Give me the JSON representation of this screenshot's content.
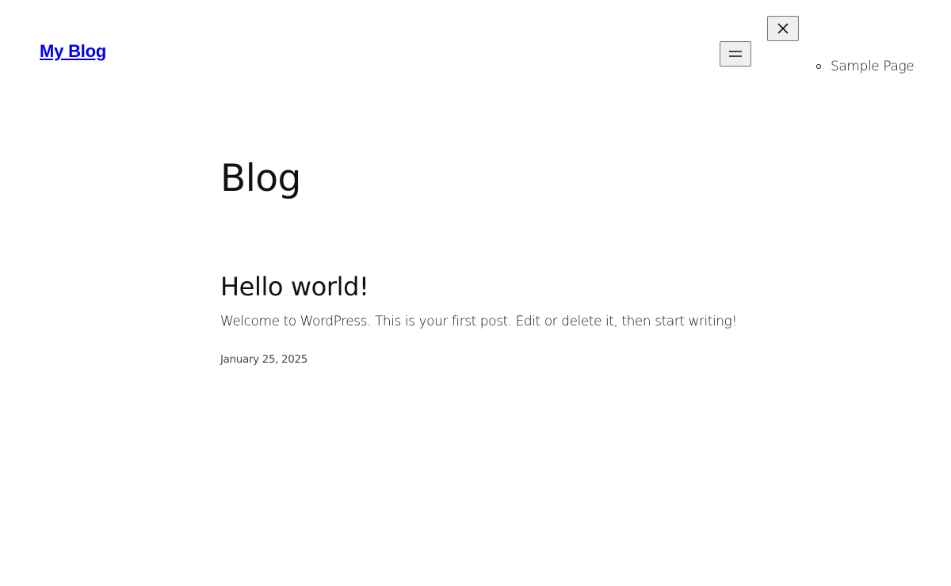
{
  "header": {
    "site_title": "My Blog",
    "menu_open_icon": "hamburger-icon",
    "menu_close_icon": "close-icon",
    "nav": [
      {
        "label": "Sample Page"
      }
    ]
  },
  "main": {
    "page_title": "Blog",
    "posts": [
      {
        "title": "Hello world!",
        "excerpt": "Welcome to WordPress. This is your first post. Edit or delete it, then start writing!",
        "date": "January 25, 2025"
      }
    ]
  }
}
